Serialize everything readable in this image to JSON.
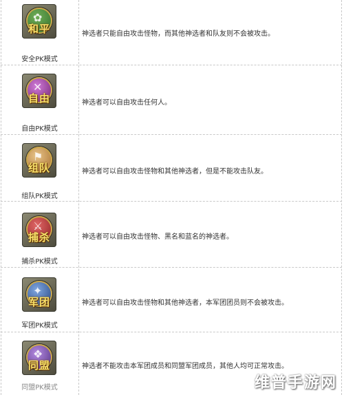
{
  "modes": [
    {
      "icon_text": "和平",
      "icon": "peace-icon",
      "color": "#2f6b2a",
      "label": "安全PK模式",
      "description": "神选者只能自由攻击怪物，而其他神选者和队友则不会被攻击。"
    },
    {
      "icon_text": "自由",
      "icon": "crossed-swords-icon",
      "color": "#8a2d7a",
      "label": "自由PK模式",
      "description": "神选者可以自由攻击任何人。"
    },
    {
      "icon_text": "组队",
      "icon": "flag-icon",
      "color": "#a36a2a",
      "label": "组队PK模式",
      "description": "神选者可以自由攻击怪物和其他神选者，但是不能攻击队友。"
    },
    {
      "icon_text": "捕杀",
      "icon": "sword-icon",
      "color": "#9a2a2a",
      "label": "捕杀PK模式",
      "description": "神选者可以自由攻击怪物、黑名和蓝名的神选者。"
    },
    {
      "icon_text": "军团",
      "icon": "eagle-icon",
      "color": "#2a4f8a",
      "label": "军团PK模式",
      "description": "神选者可以自由攻击怪物和其他神选者，本军团团员则不会被攻击。"
    },
    {
      "icon_text": "同盟",
      "icon": "alliance-icon",
      "color": "#5a3a8a",
      "label": "同盟PK模式",
      "description": "神选者不能攻击本军团成员和同盟军团成员，其他人均可正常攻击。"
    }
  ],
  "watermark": "维普手游网"
}
